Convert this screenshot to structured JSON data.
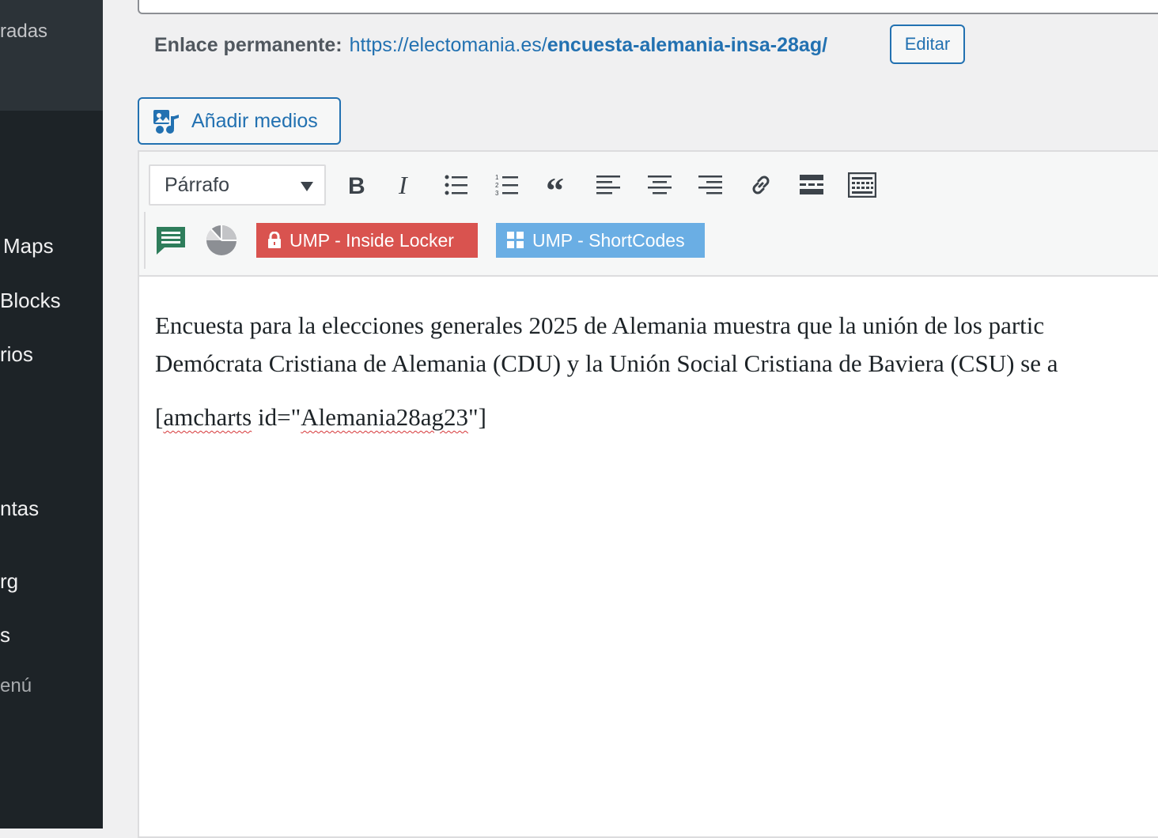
{
  "sidebar": {
    "items": [
      {
        "label": "radas",
        "kind": "small"
      },
      {
        "label": "Maps",
        "kind": "normal"
      },
      {
        "label": " Blocks",
        "kind": "normal"
      },
      {
        "label": "rios",
        "kind": "normal"
      },
      {
        "label": "ntas",
        "kind": "normal"
      },
      {
        "label": "rg",
        "kind": "normal"
      },
      {
        "label": "s",
        "kind": "normal"
      },
      {
        "label": "enú",
        "kind": "muted"
      }
    ]
  },
  "permalink": {
    "label": "Enlace permanente:",
    "base_url": "https://electomania.es/",
    "slug": "encuesta-alemania-insa-28ag/",
    "edit_label": "Editar"
  },
  "media": {
    "add_label": "Añadir medios"
  },
  "toolbar": {
    "format_value": "Párrafo",
    "buttons": [
      "bold-icon",
      "italic-icon",
      "bulleted-list-icon",
      "numbered-list-icon",
      "blockquote-icon",
      "align-left-icon",
      "align-center-icon",
      "align-right-icon",
      "link-icon",
      "read-more-icon",
      "toolbar-toggle-icon"
    ],
    "row2": {
      "comment_icon_color": "#2e7d5b",
      "chart_icon_color": "#8c8f94",
      "ump_locker_label": "UMP - Inside Locker",
      "ump_locker_color": "#d9534f",
      "ump_shortcodes_label": "UMP - ShortCodes",
      "ump_shortcodes_color": "#6aaee4"
    }
  },
  "content": {
    "line1": "Encuesta para la elecciones generales 2025 de Alemania muestra que la unión de los partic",
    "line2": "Demócrata Cristiana de Alemania (CDU) y la Unión Social Cristiana de Baviera (CSU) se a",
    "shortcode_open": "[",
    "shortcode_word": "amcharts",
    "shortcode_mid": " id=\"",
    "shortcode_id": "Alemania28ag23",
    "shortcode_close": "\"]"
  }
}
